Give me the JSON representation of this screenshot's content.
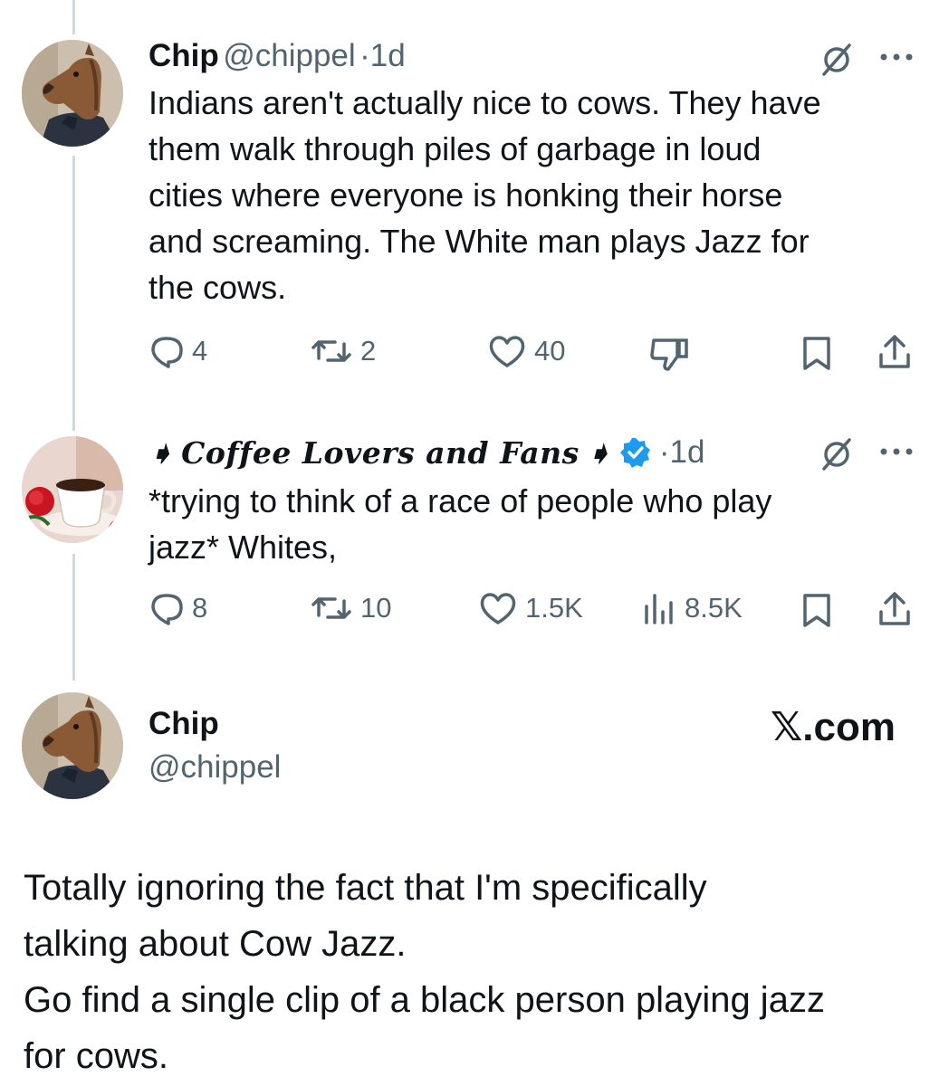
{
  "tweet1": {
    "name": "Chip",
    "handle": "@chippel",
    "separator": "·",
    "time": "1d",
    "text_lines": [
      "Indians aren't actually nice to cows. They have",
      "them walk through piles of garbage in loud",
      "cities where everyone is honking their horse",
      "and screaming. The White man plays Jazz for",
      "the cows."
    ],
    "actions": {
      "replies": "4",
      "reposts": "2",
      "likes": "40"
    },
    "icons": [
      "reply-icon",
      "repost-icon",
      "like-icon",
      "dislike-icon",
      "bookmark-icon",
      "share-icon",
      "grok-icon",
      "more-icon"
    ]
  },
  "tweet2": {
    "name": "Coffee Lovers and Fans",
    "name_prefix": "➧",
    "name_suffix": "➧",
    "separator": "·",
    "time": "1d",
    "verified": true,
    "text_lines": [
      "*trying to think of a race of people who play",
      "jazz* Whites,"
    ],
    "actions": {
      "replies": "8",
      "reposts": "10",
      "likes": "1.5K",
      "views": "8.5K"
    },
    "icons": [
      "reply-icon",
      "repost-icon",
      "like-icon",
      "views-icon",
      "bookmark-icon",
      "share-icon",
      "grok-icon",
      "more-icon"
    ]
  },
  "card": {
    "name": "Chip",
    "handle": "@chippel",
    "brand": "𝕏.com",
    "text_lines": [
      "Totally ignoring the fact that I'm specifically",
      "talking about Cow Jazz.",
      "Go find a single clip of a black person playing jazz",
      "for cows."
    ]
  },
  "colors": {
    "text": "#0f1419",
    "secondary": "#536471",
    "verified": "#1d9bf0",
    "thread_line": "#cfd9de"
  }
}
